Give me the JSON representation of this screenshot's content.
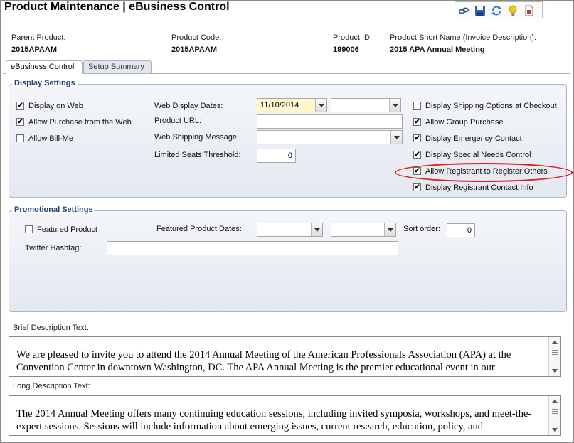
{
  "window": {
    "title": "Product Maintenance  |  eBusiness Control"
  },
  "toolbar": {
    "icons": [
      "link-icon",
      "save-icon",
      "refresh-icon",
      "lightbulb-icon",
      "document-icon"
    ]
  },
  "header": {
    "parent_product_label": "Parent Product:",
    "parent_product_value": "2015APAAM",
    "product_code_label": "Product Code:",
    "product_code_value": "2015APAAM",
    "product_id_label": "Product ID:",
    "product_id_value": "199006",
    "short_name_label": "Product Short Name (Invoice Description):",
    "short_name_value": "2015 APA Annual Meeting"
  },
  "tabs": [
    {
      "label": "eBusiness Control",
      "active": true
    },
    {
      "label": "Setup Summary",
      "active": false
    }
  ],
  "display_settings": {
    "legend": "Display Settings",
    "display_on_web": {
      "label": "Display on Web",
      "checked": true
    },
    "allow_purchase_web": {
      "label": "Allow Purchase from the Web",
      "checked": true
    },
    "allow_bill_me": {
      "label": "Allow Bill-Me",
      "checked": false
    },
    "web_display_dates_label": "Web Display Dates:",
    "web_display_start": "11/10/2014",
    "web_display_end": "",
    "product_url_label": "Product URL:",
    "product_url_value": "",
    "web_shipping_message_label": "Web Shipping Message:",
    "web_shipping_message_value": "",
    "limited_seats_label": "Limited Seats Threshold:",
    "limited_seats_value": "0",
    "display_shipping_options": {
      "label": "Display Shipping Options at Checkout",
      "checked": false
    },
    "allow_group_purchase": {
      "label": "Allow Group Purchase",
      "checked": true
    },
    "display_emergency_contact": {
      "label": "Display Emergency Contact",
      "checked": true
    },
    "display_special_needs": {
      "label": "Display Special Needs Control",
      "checked": true
    },
    "allow_register_others": {
      "label": "Allow Registrant to Register Others",
      "checked": true
    },
    "display_registrant_contact": {
      "label": "Display Registrant Contact Info",
      "checked": true
    }
  },
  "promotional_settings": {
    "legend": "Promotional Settings",
    "featured_product": {
      "label": "Featured Product",
      "checked": false
    },
    "featured_dates_label": "Featured Product Dates:",
    "featured_start": "",
    "featured_end": "",
    "sort_order_label": "Sort order:",
    "sort_order_value": "0",
    "twitter_label": "Twitter Hashtag:",
    "twitter_value": ""
  },
  "brief_description": {
    "label": "Brief Description Text:",
    "text": "We are pleased to invite you to attend the 2014 Annual Meeting of the American Professionals Association (APA) at the Convention Center in downtown Washington, DC. The APA Annual Meeting is the premier educational event in our"
  },
  "long_description": {
    "label": "Long Description Text:",
    "text": "The 2014 Annual Meeting offers many continuing education sessions, including invited symposia, workshops, and meet-the-expert sessions. Sessions will include information about emerging issues, current research, education, policy, and"
  },
  "colors": {
    "legend_text": "#1f3d7a",
    "highlight_ring": "#d61f1f",
    "date_filled_bg": "#fff8cf"
  }
}
